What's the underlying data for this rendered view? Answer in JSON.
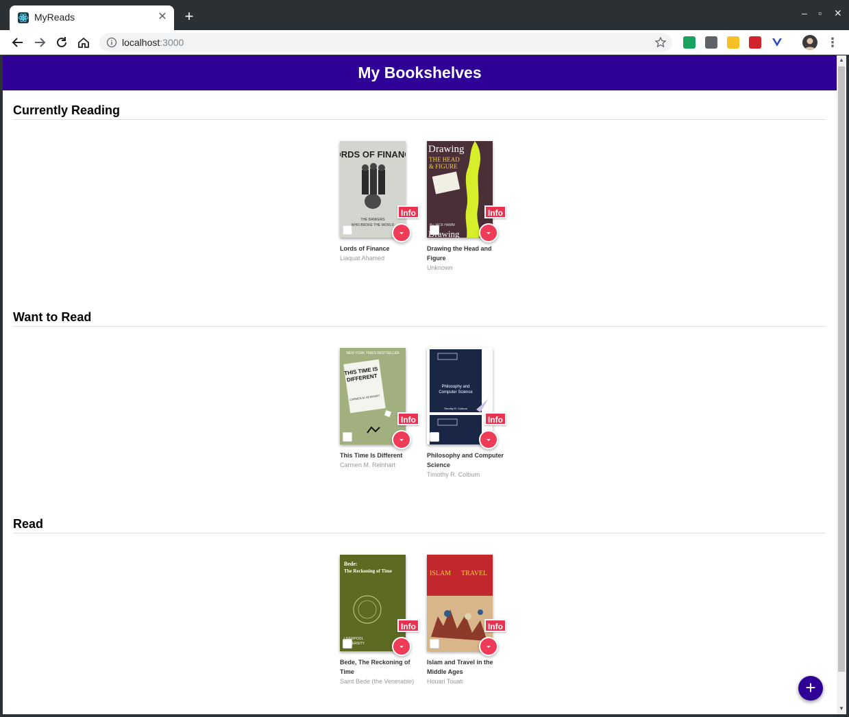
{
  "browser": {
    "tab_title": "MyReads",
    "tab_close": "✕",
    "new_tab": "+",
    "url_host": "localhost",
    "url_port": ":3000",
    "win_min": "–",
    "win_max": "▫",
    "win_close": "✕"
  },
  "app": {
    "title": "My Bookshelves",
    "fab_label": "+"
  },
  "shelves": [
    {
      "title": "Currently Reading",
      "books": [
        {
          "title": "Lords of Finance",
          "author": "Liaquat Ahamed",
          "info": "Info",
          "cover_color": "#c9cdc6",
          "cover_text": "LORDS OF FINANCE"
        },
        {
          "title": "Drawing the Head and Figure",
          "author": "Unknown",
          "info": "Info",
          "cover_color": "#4a2e35",
          "cover_text": "Drawing"
        }
      ]
    },
    {
      "title": "Want to Read",
      "books": [
        {
          "title": "This Time Is Different",
          "author": "Carmen M. Reinhart",
          "info": "Info",
          "cover_color": "#9eae7c",
          "cover_text": "THIS TIME IS DIFFERENT"
        },
        {
          "title": "Philosophy and Computer Science",
          "author": "Timothy R. Colburn",
          "info": "Info",
          "cover_color": "#1a2646",
          "cover_text": "Philosophy and Computer Science"
        }
      ]
    },
    {
      "title": "Read",
      "books": [
        {
          "title": "Bede, The Reckoning of Time",
          "author": "Saint Bede (the Venerable)",
          "info": "Info",
          "cover_color": "#5d6a22",
          "cover_text": "Bede: The Reckoning of Time"
        },
        {
          "title": "Islam and Travel in the Middle Ages",
          "author": "Houari Touati",
          "info": "Info",
          "cover_color": "#c2272d",
          "cover_text": "ISLAM TRAVEL"
        }
      ]
    }
  ]
}
